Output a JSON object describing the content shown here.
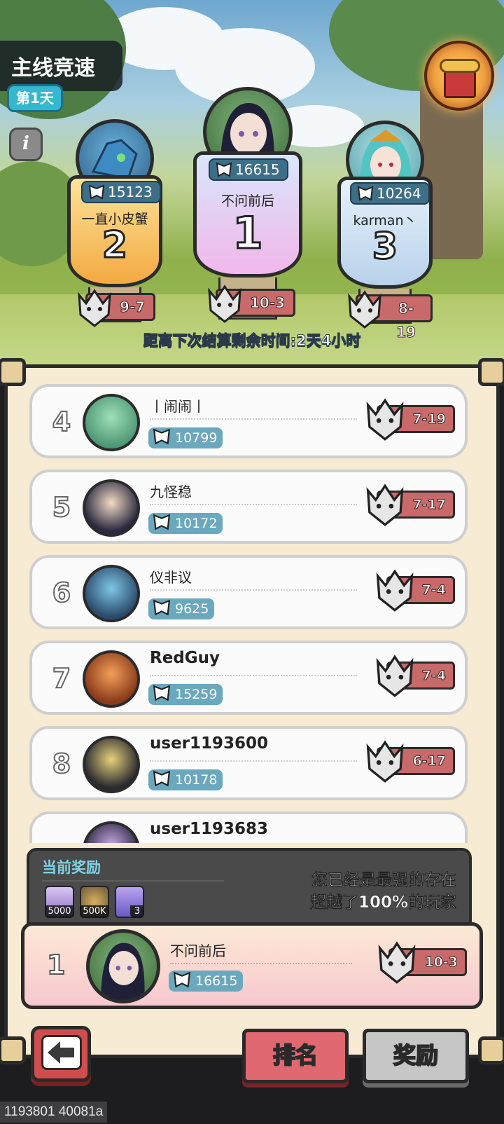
{
  "header": {
    "title": "主线竞速",
    "day_badge": "第1天",
    "info_icon": "info-icon",
    "gift_icon": "gift-box-icon"
  },
  "podium": [
    {
      "place": "2",
      "name": "一直小皮蟹",
      "power": "15123",
      "stage": "9-7"
    },
    {
      "place": "1",
      "name": "不问前后",
      "power": "16615",
      "stage": "10-3"
    },
    {
      "place": "3",
      "name": "karman丶",
      "power": "10264",
      "stage": "8-19"
    }
  ],
  "countdown": "距离下次结算剩余时间:2天4小时",
  "ranking": [
    {
      "rank": "4",
      "name": "丨闹闹丨",
      "power": "10799",
      "stage": "7-19"
    },
    {
      "rank": "5",
      "name": "九怪稳",
      "power": "10172",
      "stage": "7-17"
    },
    {
      "rank": "6",
      "name": "仪非议",
      "power": "9625",
      "stage": "7-4"
    },
    {
      "rank": "7",
      "name": "RedGuy",
      "power": "15259",
      "stage": "7-4"
    },
    {
      "rank": "8",
      "name": "user1193600",
      "power": "10178",
      "stage": "6-17"
    },
    {
      "rank": "",
      "name": "user1193683",
      "power": "",
      "stage": ""
    }
  ],
  "reward": {
    "title": "当前奖励",
    "items": [
      {
        "icon": "potion-icon",
        "qty": "5000"
      },
      {
        "icon": "gold-coin-icon",
        "qty": "500K"
      },
      {
        "icon": "time-boost-icon",
        "qty": "3"
      }
    ],
    "message_line1": "您已经是最强的存在",
    "message_line2": "超越了100%的玩家"
  },
  "me": {
    "rank": "1",
    "name": "不问前后",
    "power": "16615",
    "stage": "10-3"
  },
  "tabs": {
    "rank": "排名",
    "reward": "奖励"
  },
  "footer": "1193801 40081a",
  "colors": {
    "power_badge": "#6aa8be",
    "stage_tag": "#c96a6a",
    "active_tab": "#e06870",
    "inactive_tab": "#c6c6c6",
    "panel_bg": "#f7ebd3"
  }
}
